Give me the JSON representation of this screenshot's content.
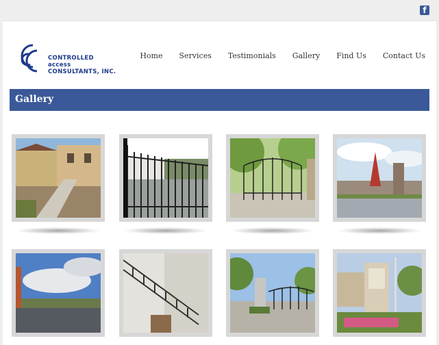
{
  "social": {
    "facebook_glyph": "f"
  },
  "logo": {
    "line1": "CONTROLLED",
    "line2": "access",
    "line3": "CONSULTANTS, INC."
  },
  "nav": [
    "Home",
    "Services",
    "Testimonials",
    "Gallery",
    "Find Us",
    "Contact Us"
  ],
  "banner": {
    "title": "Gallery"
  },
  "colors": {
    "brand": "#3b5998",
    "topbar": "#eeeeee",
    "thumb_frame": "#d7d7d7"
  },
  "gallery": [
    {
      "icon": "photo-building-ramp-icon"
    },
    {
      "icon": "photo-iron-gate-icon"
    },
    {
      "icon": "photo-entry-gate-trees-icon"
    },
    {
      "icon": "photo-stone-pillar-gate-icon"
    },
    {
      "icon": "photo-parking-lot-icon"
    },
    {
      "icon": "photo-metal-stairs-icon"
    },
    {
      "icon": "photo-gated-entrance-icon"
    },
    {
      "icon": "photo-sign-monument-icon"
    }
  ]
}
